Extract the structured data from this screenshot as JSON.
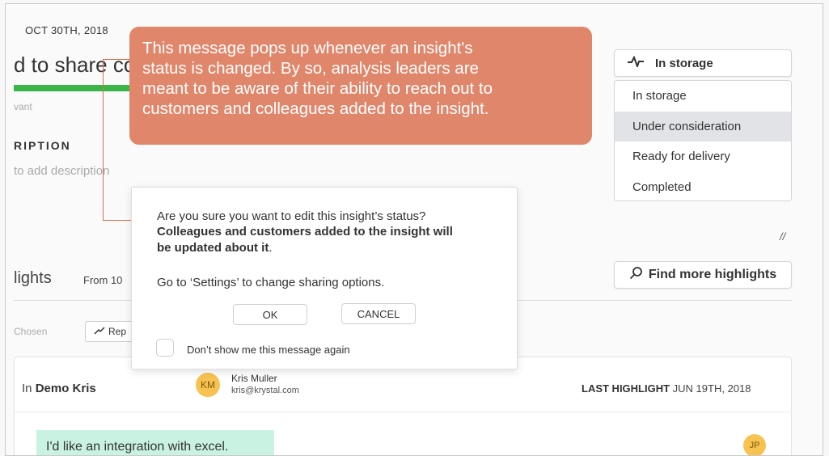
{
  "header": {
    "date": "OCT 30TH, 2018",
    "title_partial": "d to share co",
    "relevance_partial": "vant",
    "progress": 1.0
  },
  "description": {
    "label_partial": "RIPTION",
    "placeholder_partial": "to add description"
  },
  "status_dropdown": {
    "selected": "In storage",
    "options": [
      "In storage",
      "Under consideration",
      "Ready for delivery",
      "Completed"
    ],
    "highlighted_option": "Under consideration"
  },
  "callout": {
    "text": "This message pops up whenever an insight's\nstatus is changed. By so, analysis leaders are\nmeant to be aware of their ability to reach out to\ncustomers and colleagues added to the insight.",
    "color": "#e0866b"
  },
  "dialog": {
    "question": "Are you sure you want to edit this insight’s status?",
    "bold_notice": "Colleagues and customers added to the insight will",
    "bold_notice_2": "be updated about it",
    "bold_notice_end": ".",
    "settings_hint": "Go to ‘Settings’ to change sharing options.",
    "ok_label": "OK",
    "cancel_label": "CANCEL",
    "dont_show_label": "Don’t show me this message again"
  },
  "highlights": {
    "heading_partial": "lights",
    "from_partial": "From 10",
    "find_more_label": "Find more highlights",
    "chosen_partial": "Chosen",
    "rep_partial": "Rep"
  },
  "card": {
    "in_prefix": "In",
    "in_name": "Demo Kris",
    "avatar_initials": "KM",
    "person_name": "Kris Muller",
    "person_email": "kris@krystal.com",
    "last_highlight_label": "LAST HIGHLIGHT",
    "last_highlight_date": "JUN 19TH, 2018",
    "quote": "I'd like an integration with excel.",
    "second_avatar": "JP"
  },
  "icons": {
    "status": "activity-pulse-icon",
    "search": "search-icon",
    "trend": "trend-icon",
    "resize": "resize-icon"
  },
  "colors": {
    "accent_green": "#39b54a",
    "callout_orange": "#e0866b",
    "avatar_yellow": "#f7c250",
    "quote_highlight": "#c9f2e2"
  }
}
